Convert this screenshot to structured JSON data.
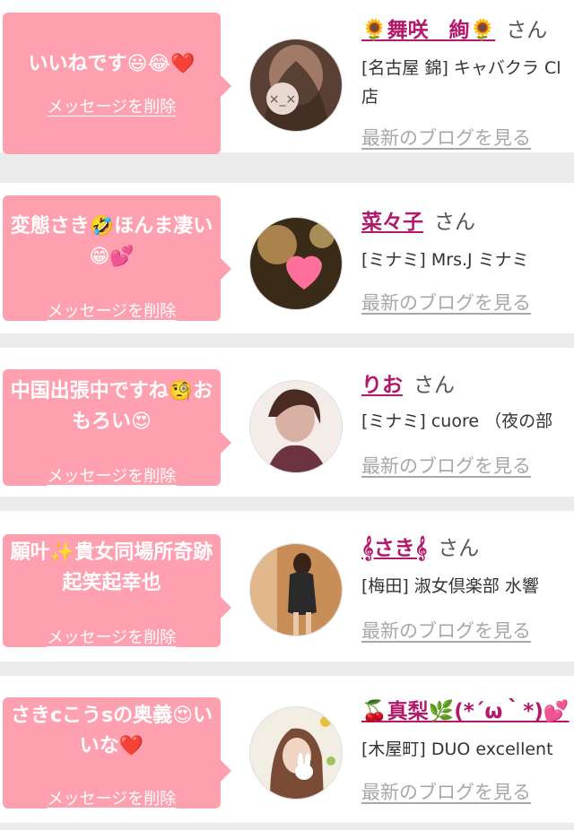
{
  "delete_label": "メッセージを削除",
  "blog_label": "最新のブログを見る",
  "san_label": "さん",
  "messages": [
    {
      "comment": "いいねです😃😂❤️",
      "name": "🌻舞咲　絢🌻",
      "shop": "[名古屋 錦] キャバクラ Cl 店",
      "avatar_colors": [
        "#5a4034",
        "#a07a66",
        "#e8d8cf"
      ]
    },
    {
      "comment": "変態さき🤣ほんま凄い😁💕",
      "name": "菜々子",
      "shop": "[ミナミ] Mrs.J ミナミ",
      "avatar_colors": [
        "#3a2a18",
        "#c79a5a",
        "#ff6f9c"
      ]
    },
    {
      "comment": "中国出張中ですね🧐おもろい😍",
      "name": "りお",
      "shop": "[ミナミ] cuore （夜の部",
      "avatar_colors": [
        "#6b3440",
        "#d9b0a4",
        "#f4ece8"
      ]
    },
    {
      "comment": "願叶✨貴女同場所奇跡起笑起幸也",
      "name": "𝄞さき𝄞",
      "shop": "[梅田] 淑女倶楽部 水響",
      "avatar_colors": [
        "#c98e58",
        "#2a2a2a",
        "#e0b88c"
      ]
    },
    {
      "comment": "さきcこうsの奥義😍いいな❤️",
      "name": "🍒真梨🌿(*´ω｀*)💕",
      "shop": "[木屋町] DUO excellent",
      "avatar_colors": [
        "#f2eee4",
        "#7a4c36",
        "#ffffff"
      ]
    }
  ]
}
